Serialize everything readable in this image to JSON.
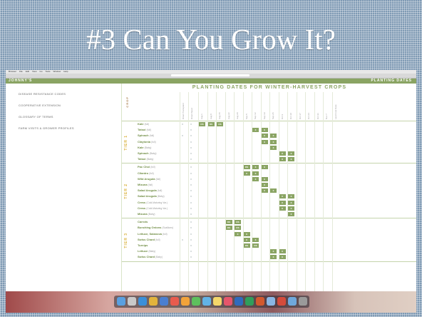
{
  "slide": {
    "title": "#3  Can You Grow It?"
  },
  "os": {
    "menu_items": [
      "Browser",
      "File",
      "Edit",
      "View",
      "Go",
      "Tools",
      "Window",
      "Help"
    ],
    "url": "Seeds Tab: 2017-18 Vol 17 88 00 08"
  },
  "site": {
    "brand": "JOHNNY'S",
    "right_label": "PLANTING DATES"
  },
  "sidenav": {
    "items": [
      "DISEASE RESISTANCE CODES",
      "COOPERATIVE EXTENSION",
      "GLOSSARY OF TERMS",
      "FARM VISITS & GROWER PROFILES"
    ]
  },
  "chart": {
    "title": "PLANTING DATES FOR WINTER-HARVEST CROPS",
    "crop_header": "CROP",
    "column_headers": [
      "Direct Transplant",
      "Direct Seed",
      "Aug 1",
      "Aug 8",
      "Aug 15",
      "Aug 22",
      "Aug 29",
      "Sep 5",
      "Sep 12",
      "Sep 19",
      "Sep 26",
      "Oct 3",
      "Oct 10",
      "Oct 17",
      "Oct 24",
      "Oct 31",
      "Nov 7",
      "Last Frost Date"
    ],
    "tiers": [
      {
        "label": "TIER 1",
        "rows": [
          {
            "name": "Kale",
            "note": "(full)",
            "mark1": "x",
            "mark2": "x",
            "start": 0,
            "span": 3,
            "labels": [
              "DS",
              "DS",
              "DS"
            ]
          },
          {
            "name": "Tatsoi",
            "note": "(full)",
            "mark1": "",
            "mark2": "x",
            "start": 6,
            "span": 2,
            "labels": [
              "X",
              "X"
            ]
          },
          {
            "name": "Spinach",
            "note": "(full)",
            "mark1": "x",
            "mark2": "x",
            "start": 7,
            "span": 2,
            "labels": [
              "X",
              "X"
            ]
          },
          {
            "name": "Claytonia",
            "note": "(full)",
            "mark1": "",
            "mark2": "x",
            "start": 7,
            "span": 2,
            "labels": [
              "X",
              "X"
            ]
          },
          {
            "name": "Kale",
            "note": "(Baby)",
            "mark1": "",
            "mark2": "x",
            "start": 8,
            "span": 1,
            "labels": [
              "X"
            ]
          },
          {
            "name": "Spinach",
            "note": "(Baby)",
            "mark1": "",
            "mark2": "x",
            "start": 9,
            "span": 2,
            "labels": [
              "X",
              "X"
            ]
          },
          {
            "name": "Tatsoi",
            "note": "(Baby)",
            "mark1": "",
            "mark2": "x",
            "start": 9,
            "span": 2,
            "labels": [
              "X",
              "X"
            ]
          }
        ]
      },
      {
        "label": "TIER 2",
        "rows": [
          {
            "name": "Pac Choi",
            "note": "(full)",
            "mark1": "",
            "mark2": "x",
            "start": 5,
            "span": 3,
            "labels": [
              "DS",
              "X",
              "X"
            ]
          },
          {
            "name": "Cilantro",
            "note": "(full)",
            "mark1": "",
            "mark2": "x",
            "start": 5,
            "span": 2,
            "labels": [
              "X",
              "X"
            ]
          },
          {
            "name": "Wild Arugula",
            "note": "(full)",
            "mark1": "",
            "mark2": "x",
            "start": 6,
            "span": 2,
            "labels": [
              "X",
              "X"
            ]
          },
          {
            "name": "Mizuna",
            "note": "(full)",
            "mark1": "",
            "mark2": "x",
            "start": 7,
            "span": 1,
            "labels": [
              "X"
            ]
          },
          {
            "name": "Salad Arugula",
            "note": "(full)",
            "mark1": "",
            "mark2": "x",
            "start": 7,
            "span": 2,
            "labels": [
              "X",
              "X"
            ]
          },
          {
            "name": "Salad Arugula",
            "note": "(Baby)",
            "mark1": "",
            "mark2": "x",
            "start": 9,
            "span": 2,
            "labels": [
              "X",
              "X"
            ]
          },
          {
            "name": "Cress",
            "note": "(Cold-Maturing Var.)",
            "mark1": "",
            "mark2": "x",
            "start": 9,
            "span": 2,
            "labels": [
              "X",
              "X"
            ]
          },
          {
            "name": "Cress",
            "note": "(Cold-Maturing Var.)",
            "mark1": "",
            "mark2": "x",
            "start": 9,
            "span": 2,
            "labels": [
              "X",
              "X"
            ]
          },
          {
            "name": "Mizuna",
            "note": "(Baby)",
            "mark1": "",
            "mark2": "x",
            "start": 10,
            "span": 1,
            "labels": [
              "X"
            ]
          }
        ]
      },
      {
        "label": "TIER 3",
        "rows": [
          {
            "name": "Carrots",
            "note": "",
            "mark1": "",
            "mark2": "x",
            "start": 3,
            "span": 2,
            "labels": [
              "DS",
              "DS"
            ]
          },
          {
            "name": "Bunching Onions",
            "note": "(Scallions)",
            "mark1": "",
            "mark2": "x",
            "start": 3,
            "span": 2,
            "labels": [
              "DS",
              "DS"
            ]
          },
          {
            "name": "Lettuce, Salanova",
            "note": "(full)",
            "mark1": "",
            "mark2": "x",
            "start": 4,
            "span": 2,
            "labels": [
              "X",
              "X"
            ]
          },
          {
            "name": "Swiss Chard",
            "note": "(full)",
            "mark1": "x",
            "mark2": "x",
            "start": 5,
            "span": 2,
            "labels": [
              "X",
              "X"
            ]
          },
          {
            "name": "Turnips",
            "note": "",
            "mark1": "",
            "mark2": "x",
            "start": 5,
            "span": 2,
            "labels": [
              "DS",
              "DS"
            ]
          },
          {
            "name": "Lettuce",
            "note": "(Baby)",
            "mark1": "",
            "mark2": "x",
            "start": 8,
            "span": 2,
            "labels": [
              "X",
              "X"
            ]
          },
          {
            "name": "Swiss Chard",
            "note": "(Baby)",
            "mark1": "",
            "mark2": "x",
            "start": 8,
            "span": 2,
            "labels": [
              "X",
              "X"
            ]
          }
        ]
      }
    ]
  },
  "colors": {
    "accent_green": "#8aa463",
    "tier_label": "#d9b23c",
    "slide_bg": "#7f9ab4"
  },
  "dock": {
    "icons": [
      "finder-icon",
      "launchpad-icon",
      "safari-icon",
      "chrome-icon",
      "mail-icon",
      "calendar-icon",
      "photos-icon",
      "messages-icon",
      "maps-icon",
      "notes-icon",
      "music-icon",
      "word-icon",
      "excel-icon",
      "powerpoint-icon",
      "preview-icon",
      "pdf-icon",
      "folder-icon",
      "trash-icon"
    ]
  }
}
